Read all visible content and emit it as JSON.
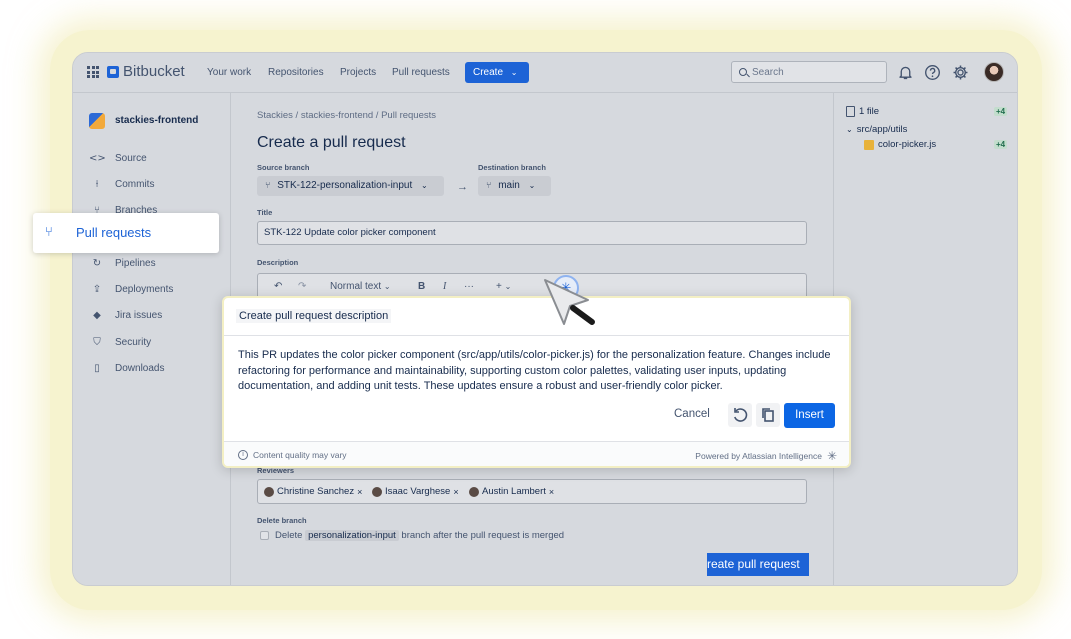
{
  "app": {
    "name": "Bitbucket"
  },
  "topnav": {
    "links": [
      "Your work",
      "Repositories",
      "Projects",
      "Pull requests"
    ],
    "create_label": "Create",
    "search_placeholder": "Search",
    "icons": [
      "notification-icon",
      "help-icon",
      "settings-icon"
    ]
  },
  "sidebar": {
    "repo_name": "stackies-frontend",
    "items": [
      {
        "label": "Source",
        "icon": "code-icon",
        "glyph": "<>"
      },
      {
        "label": "Commits",
        "icon": "commit-icon",
        "glyph": "⍿"
      },
      {
        "label": "Branches",
        "icon": "branch-icon",
        "glyph": "⑂"
      },
      {
        "label": "Pull requests",
        "icon": "pull-request-icon",
        "glyph": "⑂"
      },
      {
        "label": "Pipelines",
        "icon": "pipelines-icon",
        "glyph": "↻"
      },
      {
        "label": "Deployments",
        "icon": "deployments-icon",
        "glyph": "⇪"
      },
      {
        "label": "Jira issues",
        "icon": "jira-icon",
        "glyph": "◆"
      },
      {
        "label": "Security",
        "icon": "shield-icon",
        "glyph": "⛉"
      },
      {
        "label": "Downloads",
        "icon": "file-icon",
        "glyph": "▯"
      }
    ],
    "active": "Pull requests"
  },
  "main": {
    "breadcrumbs": [
      "Stackies",
      "stackies-frontend",
      "Pull requests"
    ],
    "breadcrumb_sep": " / ",
    "title": "Create a pull request",
    "source_branch_label": "Source branch",
    "source_branch": "STK-122-personalization-input",
    "destination_branch_label": "Destination branch",
    "destination_branch": "main",
    "title_label": "Title",
    "title_value": "STK-122 Update color picker component",
    "description_label": "Description",
    "toolbar": {
      "text_style": "Normal text",
      "bold": "B",
      "italic": "I",
      "more": "···",
      "insert": "+"
    },
    "reviewers_label": "Reviewers",
    "reviewers": [
      "Christine Sanchez",
      "Isaac Varghese",
      "Austin Lambert"
    ],
    "delete_branch_label": "Delete branch",
    "delete_text_pre": "Delete",
    "delete_branch_name": "personalization-input",
    "delete_text_post": "branch after the pull request is merged",
    "create_button": "Create pull request"
  },
  "files_panel": {
    "count_label": "1 file",
    "count_diff": "+4",
    "folder": "src/app/utils",
    "file": "color-picker.js",
    "file_diff": "+4"
  },
  "ai_dialog": {
    "title": "Create pull request description",
    "body": "This PR updates the color picker component (src/app/utils/color-picker.js) for the personalization feature. Changes include refactoring for performance and maintainability, supporting custom color palettes, validating user inputs, updating documentation, and adding unit tests. These updates ensure a robust and user-friendly color picker.",
    "cancel": "Cancel",
    "insert": "Insert",
    "footer_left": "Content quality may vary",
    "footer_right": "Powered by Atlassian Intelligence"
  },
  "colors": {
    "accent": "#1d63d6",
    "insert_button": "#0c66e4",
    "glow": "#f6f3cf"
  }
}
